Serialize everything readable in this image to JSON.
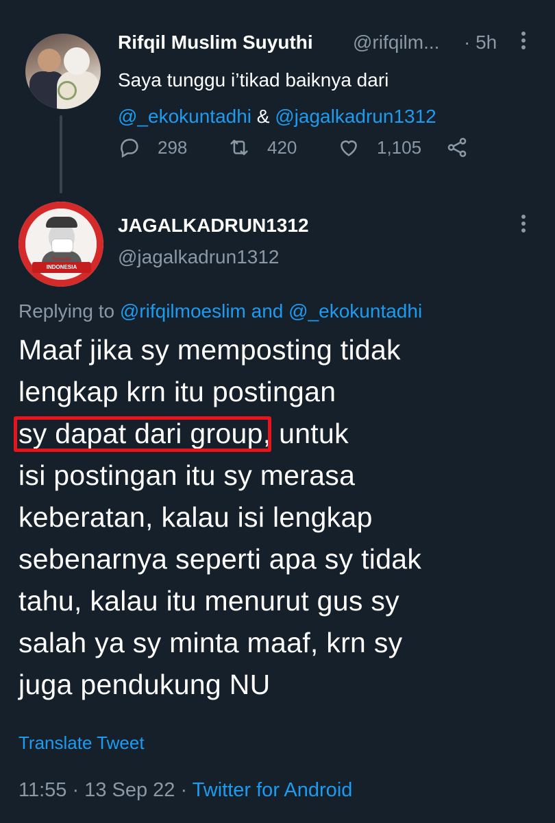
{
  "colors": {
    "background": "#15202b",
    "text_primary": "#ffffff",
    "text_secondary": "#8b98a5",
    "link": "#1d9bf0",
    "highlight_box": "#e8141b"
  },
  "tweet1": {
    "display_name": "Rifqil Muslim Suyuthi",
    "handle": "@rifqilm...",
    "time": "· 5h",
    "text_line1": "Saya tunggu i’tikad baiknya dari",
    "mention1": "@_ekokuntadhi",
    "ampersand": " & ",
    "mention2": "@jagalkadrun1312",
    "reply_icon": "comment-icon",
    "reply_count": "298",
    "retweet_icon": "retweet-icon",
    "retweet_count": "420",
    "like_icon": "heart-icon",
    "like_count": "1,105",
    "share_icon": "share-icon",
    "more_icon": "more-vertical-icon"
  },
  "tweet2": {
    "display_name": "JAGALKADRUN1312",
    "handle": "@jagalkadrun1312",
    "avatar_text": "INDONESIA",
    "reply_prefix": "Replying to ",
    "reply_mention1": "@rifqilmoeslim",
    "reply_and": " and ",
    "reply_mention2": "@_ekokuntadhi",
    "lines": [
      "Maaf jika sy memposting tidak",
      "lengkap krn itu postingan",
      "sy dapat dari group",
      ", untuk",
      "isi postingan itu sy merasa",
      "keberatan, kalau isi lengkap",
      "sebenarnya seperti apa sy tidak",
      "tahu, kalau itu menurut gus sy",
      "salah ya sy minta maaf, krn sy",
      "juga pendukung NU"
    ],
    "translate_label": "Translate Tweet",
    "timestamp": "11:55 · 13 Sep 22 · ",
    "source": "Twitter for Android",
    "more_icon": "more-vertical-icon"
  }
}
